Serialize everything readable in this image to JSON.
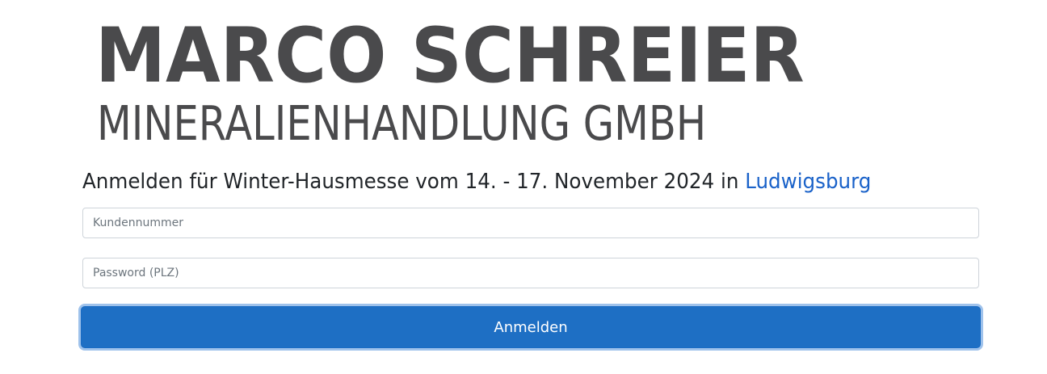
{
  "logo": {
    "line1": "MARCO SCHREIER",
    "line2": "MINERALIENHANDLUNG GMBH"
  },
  "heading": {
    "text": "Anmelden für Winter-Hausmesse vom 14. - 17. November 2024 in ",
    "link": "Ludwigsburg"
  },
  "form": {
    "customer_placeholder": "Kundennummer",
    "password_placeholder": "Password (PLZ)",
    "submit_label": "Anmelden"
  },
  "colors": {
    "logo": "#4a4a4c",
    "link": "#1a62c9",
    "button": "#1e6fc4",
    "button_focus_ring": "#9fc2eb"
  }
}
